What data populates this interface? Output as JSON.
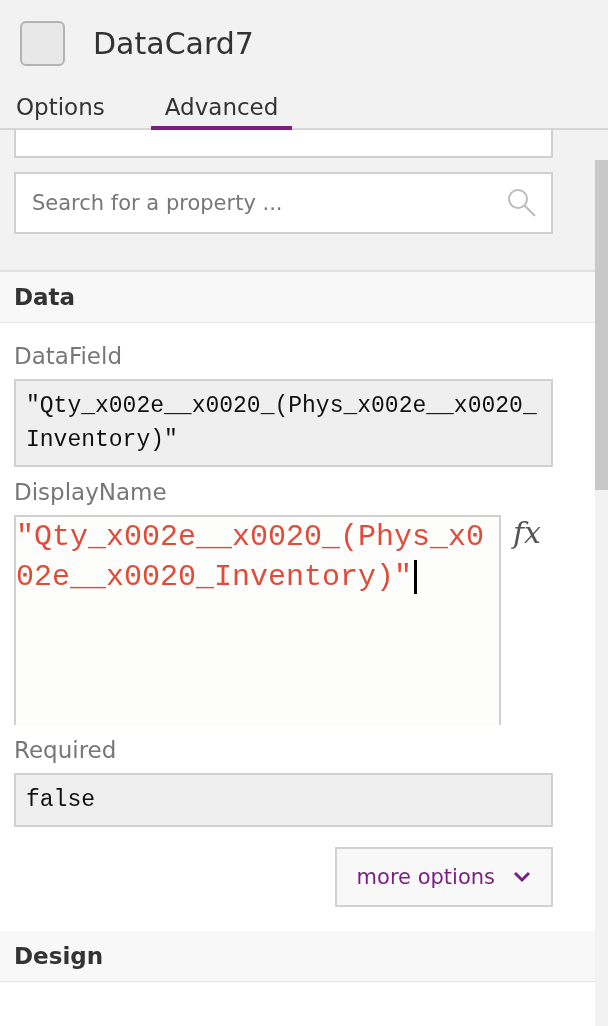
{
  "header": {
    "title": "DataCard7"
  },
  "tabs": [
    {
      "label": "Options",
      "selected": false
    },
    {
      "label": "Advanced",
      "selected": true
    }
  ],
  "search": {
    "placeholder": "Search for a property ..."
  },
  "sections": [
    {
      "title": "Data",
      "properties": [
        {
          "label": "DataField",
          "value": "\"Qty_x002e__x0020_(Phys_x002e__x0020_Inventory)\"",
          "kind": "readonly"
        },
        {
          "label": "DisplayName",
          "value": "\"Qty_x002e__x0020_(Phys_x002e__x0020_Inventory)\"",
          "kind": "formula",
          "fx": "fx"
        },
        {
          "label": "Required",
          "value": "false",
          "kind": "readonly"
        }
      ],
      "more": "more options"
    },
    {
      "title": "Design"
    }
  ]
}
